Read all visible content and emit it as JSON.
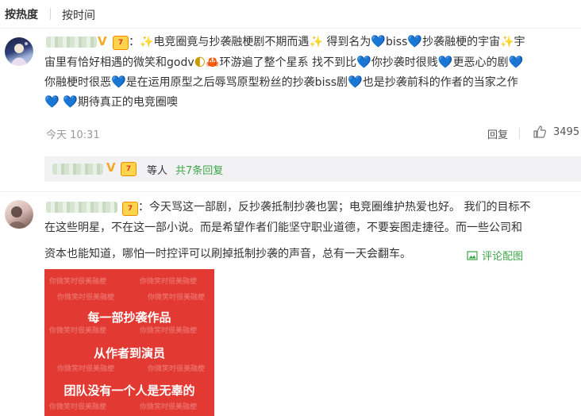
{
  "sort_tabs": {
    "hot": "按热度",
    "time": "按时间"
  },
  "comments": [
    {
      "verified_mark": "V",
      "vip_mark": "7",
      "lines": [
        [
          {
            "t": "：",
            "cls": ""
          },
          {
            "t": "✨",
            "cls": "sparkle",
            "icon": "sparkle-emoji"
          },
          {
            "t": "电竞圈竟与抄袭融梗剧不期而遇",
            "cls": ""
          },
          {
            "t": "✨",
            "cls": "sparkle",
            "icon": "sparkle-emoji"
          },
          {
            "t": " 得到名为",
            "cls": ""
          },
          {
            "t": "💙",
            "cls": "heart",
            "icon": "blue-heart-emoji"
          },
          {
            "t": "biss",
            "cls": ""
          },
          {
            "t": "💙",
            "cls": "heart",
            "icon": "blue-heart-emoji"
          },
          {
            "t": "抄袭融梗的宇宙",
            "cls": ""
          },
          {
            "t": "✨",
            "cls": "sparkle",
            "icon": "sparkle-emoji"
          },
          {
            "t": "宇",
            "cls": ""
          }
        ],
        [
          {
            "t": "宙里有恰好相遇的微笑和godv",
            "cls": ""
          },
          {
            "t": "🌓",
            "cls": "moon",
            "icon": "moon-emoji"
          },
          {
            "t": "🦀",
            "cls": "crab",
            "icon": "crab-emoji"
          },
          {
            "t": "环游遍了整个星系 找不到比",
            "cls": ""
          },
          {
            "t": "💙",
            "cls": "heart",
            "icon": "blue-heart-emoji"
          },
          {
            "t": "你抄袭时很贱",
            "cls": ""
          },
          {
            "t": "💙",
            "cls": "heart",
            "icon": "blue-heart-emoji"
          },
          {
            "t": "更恶心的剧",
            "cls": ""
          },
          {
            "t": "💙",
            "cls": "heart",
            "icon": "blue-heart-emoji"
          }
        ],
        [
          {
            "t": "你融梗时很恶",
            "cls": ""
          },
          {
            "t": "💙",
            "cls": "heart",
            "icon": "blue-heart-emoji"
          },
          {
            "t": "是在运用原型之后辱骂原型粉丝的抄袭biss剧",
            "cls": ""
          },
          {
            "t": "💙",
            "cls": "heart",
            "icon": "blue-heart-emoji"
          },
          {
            "t": "也是抄袭前科的作者的当家之作",
            "cls": ""
          }
        ],
        [
          {
            "t": "💙",
            "cls": "heart",
            "icon": "blue-heart-emoji"
          },
          {
            "t": " ",
            "cls": ""
          },
          {
            "t": "💙",
            "cls": "heart",
            "icon": "blue-heart-emoji"
          },
          {
            "t": "期待真正的电竞圈噢",
            "cls": ""
          }
        ]
      ],
      "time": "今天 10:31",
      "reply_label": "回复",
      "like_count": "3495",
      "reply_summary": {
        "people": "等人",
        "more": "共7条回复"
      }
    },
    {
      "vip_mark": "7",
      "lines": [
        "：今天骂这一部剧，反抄袭抵制抄袭也罢；电竞圈维护热爱也好。 我们的目标不",
        "在这些明星，不在这一部小说。而是希望作者们能坚守职业道德，不要妄图走捷径。而一些公司和",
        "资本也能知道，哪怕一时控评可以刷掉抵制抄袭的声音，总有一天会翻车。"
      ],
      "image_link": "评论配图",
      "poster": {
        "watermark": "你微笑时很美融梗",
        "lines": [
          "每一部抄袭作品",
          "从作者到演员",
          "团队没有一个人是无辜的"
        ]
      }
    }
  ],
  "colors": {
    "accent_green": "#3ea548",
    "heart_blue": "#33b6e6",
    "poster_red": "#e23a32"
  }
}
